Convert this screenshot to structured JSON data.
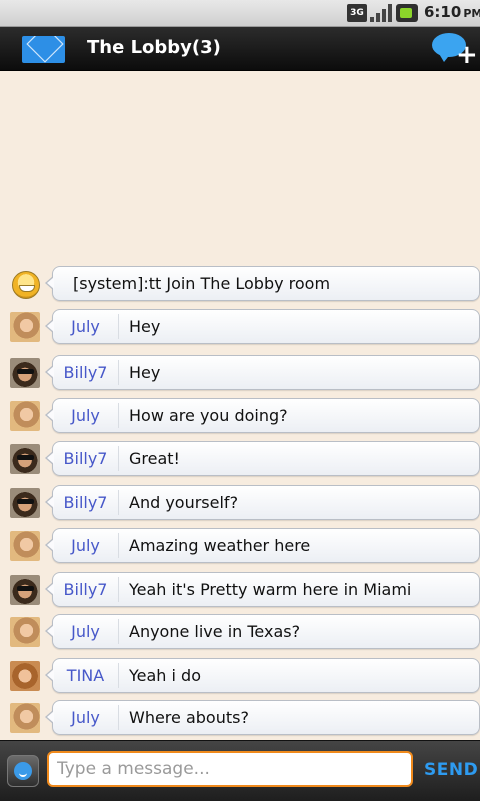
{
  "status_bar": {
    "network": "3G",
    "time": "6:10",
    "period": "PM"
  },
  "header": {
    "title": "The Lobby(3)",
    "left_icon": "mail-icon",
    "right_icon": "new-chat-icon"
  },
  "messages": [
    {
      "sender": "",
      "type": "system",
      "avatar": "system-smiley",
      "text": "[system]:tt Join The Lobby room"
    },
    {
      "sender": "July",
      "avatar": "july",
      "text": "Hey"
    },
    {
      "sender": "Billy7",
      "avatar": "billy",
      "text": "Hey"
    },
    {
      "sender": "July",
      "avatar": "july",
      "text": "How are you doing?"
    },
    {
      "sender": "Billy7",
      "avatar": "billy",
      "text": "Great!"
    },
    {
      "sender": "Billy7",
      "avatar": "billy",
      "text": "And yourself?"
    },
    {
      "sender": "July",
      "avatar": "july",
      "text": "Amazing weather here"
    },
    {
      "sender": "Billy7",
      "avatar": "billy",
      "text": "Yeah it's Pretty warm here in Miami"
    },
    {
      "sender": "July",
      "avatar": "july",
      "text": "Anyone live in Texas?"
    },
    {
      "sender": "TINA",
      "avatar": "tina",
      "text": "Yeah i do"
    },
    {
      "sender": "July",
      "avatar": "july",
      "text": "Where abouts?"
    }
  ],
  "composer": {
    "placeholder": "Type a message...",
    "value": "",
    "send_label": "SEND"
  },
  "colors": {
    "background": "#f7ecdf",
    "sender_name": "#4758c9",
    "input_border": "#f08a1c",
    "send_text": "#2e9bf0"
  }
}
